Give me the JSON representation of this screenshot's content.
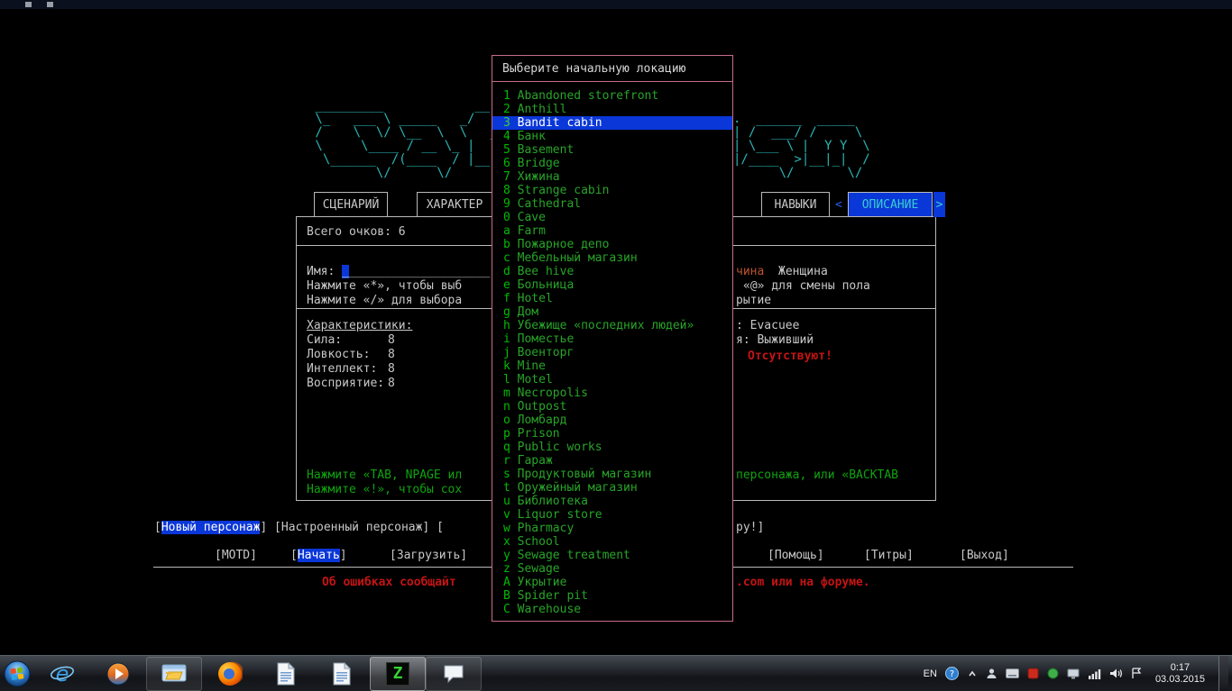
{
  "colors": {
    "terminal_bg": "#000000",
    "text_white": "#c8c8c8",
    "ascii_cyan": "#2cb5b5",
    "help_green": "#0fa30f",
    "error_red": "#c41414",
    "selection_blue": "#0a37d8",
    "dialog_border_pink": "#c76b8d",
    "gender_selected_brown": "#bf5330"
  },
  "game": {
    "logo_lines": [
      " _________            __                   .__",
      " \\_   ___ \\ _____   _/  |_ _____     ____  |  |   ___.__.  ______  _____",
      " /    \\  \\/ \\__  \\  \\   __\\\\__  \\  _/ ___\\ |  |  <   |  | /  ___/ /     \\",
      " \\     \\____ / __ \\_ |  |   / __ \\_\\  \\___ |  |__ \\___  | \\___ \\ |  Y Y  \\",
      "  \\______  /(____  / |__|  (____  / \\___  >|____/ / ____|/____  >|__|_|  /",
      "         \\/      \\/             \\/      \\/        \\/          \\/       \\/"
    ],
    "tabs": {
      "scenario": "СЦЕНАРИЙ",
      "character": "ХАРАКТЕР",
      "skills": "НАВЫКИ",
      "description": "ОПИСАНИЕ",
      "prev_arrow": "<",
      "next_arrow": ">"
    },
    "points_line": "Всего очков: 6",
    "name_row": {
      "label": "Имя: ",
      "cursor": "_",
      "underscores": "____________________"
    },
    "hints_left": {
      "line1": "Нажмите «*», чтобы выб",
      "line2": "Нажмите «/» для выбора"
    },
    "gender": {
      "male_fragment": "чина",
      "female": "Женщина",
      "hint_fragment": "«@» для смены пола",
      "shelter_fragment": "рытие"
    },
    "stats": {
      "header": "Характеристики:",
      "rows": [
        {
          "label": "Сила:",
          "value": "8"
        },
        {
          "label": "Ловкость:",
          "value": "8"
        },
        {
          "label": "Интеллект:",
          "value": "8"
        },
        {
          "label": "Восприятие:",
          "value": "8"
        }
      ]
    },
    "right_info": {
      "scenario_fragment": ": Evacuee",
      "profession_fragment": "я: Выживший",
      "skills_missing": "Отсутствуют!"
    },
    "help_green": {
      "line1_left": "Нажмите «TAB, NPAGE ил",
      "line1_right": "персонажа, или «BACKTAB",
      "line2_left": "Нажмите «!», чтобы сох"
    },
    "menu_row1": {
      "open_bracket": "[",
      "new_character": "Новый персонаж",
      "rest": "] [Настроенный персонаж] [",
      "right_fragment": "ру!]"
    },
    "menu_row2": {
      "motd": "[MOTD]",
      "start_open": "[",
      "start": "Начать",
      "start_close": "]",
      "load": "[Загрузить]",
      "help": "[Помощь]",
      "credits": "[Титры]",
      "quit": "[Выход]"
    },
    "bug_line": {
      "left_fragment": "Об ошибках сообщайт",
      "right_fragment": ".com или на форуме."
    }
  },
  "dialog": {
    "title": "Выберите начальную локацию",
    "items": [
      {
        "key": "1",
        "label": "Abandoned storefront",
        "selected": false
      },
      {
        "key": "2",
        "label": "Anthill",
        "selected": false
      },
      {
        "key": "3",
        "label": "Bandit cabin",
        "selected": true
      },
      {
        "key": "4",
        "label": "Банк",
        "selected": false
      },
      {
        "key": "5",
        "label": "Basement",
        "selected": false
      },
      {
        "key": "6",
        "label": "Bridge",
        "selected": false
      },
      {
        "key": "7",
        "label": "Хижина",
        "selected": false
      },
      {
        "key": "8",
        "label": "Strange cabin",
        "selected": false
      },
      {
        "key": "9",
        "label": "Cathedral",
        "selected": false
      },
      {
        "key": "0",
        "label": "Cave",
        "selected": false
      },
      {
        "key": "a",
        "label": "Farm",
        "selected": false
      },
      {
        "key": "b",
        "label": "Пожарное депо",
        "selected": false
      },
      {
        "key": "c",
        "label": "Мебельный магазин",
        "selected": false
      },
      {
        "key": "d",
        "label": "Bee hive",
        "selected": false
      },
      {
        "key": "e",
        "label": "Больница",
        "selected": false
      },
      {
        "key": "f",
        "label": "Hotel",
        "selected": false
      },
      {
        "key": "g",
        "label": "Дом",
        "selected": false
      },
      {
        "key": "h",
        "label": "Убежище «последних людей»",
        "selected": false
      },
      {
        "key": "i",
        "label": "Поместье",
        "selected": false
      },
      {
        "key": "j",
        "label": "Военторг",
        "selected": false
      },
      {
        "key": "k",
        "label": "Mine",
        "selected": false
      },
      {
        "key": "l",
        "label": "Motel",
        "selected": false
      },
      {
        "key": "m",
        "label": "Necropolis",
        "selected": false
      },
      {
        "key": "n",
        "label": "Outpost",
        "selected": false
      },
      {
        "key": "o",
        "label": "Ломбард",
        "selected": false
      },
      {
        "key": "p",
        "label": "Prison",
        "selected": false
      },
      {
        "key": "q",
        "label": "Public works",
        "selected": false
      },
      {
        "key": "r",
        "label": "Гараж",
        "selected": false
      },
      {
        "key": "s",
        "label": "Продуктовый магазин",
        "selected": false
      },
      {
        "key": "t",
        "label": "Оружейный магазин",
        "selected": false
      },
      {
        "key": "u",
        "label": "Библиотека",
        "selected": false
      },
      {
        "key": "v",
        "label": "Liquor store",
        "selected": false
      },
      {
        "key": "w",
        "label": "Pharmacy",
        "selected": false
      },
      {
        "key": "x",
        "label": "School",
        "selected": false
      },
      {
        "key": "y",
        "label": "Sewage treatment",
        "selected": false
      },
      {
        "key": "z",
        "label": "Sewage",
        "selected": false
      },
      {
        "key": "A",
        "label": "Укрытие",
        "selected": false
      },
      {
        "key": "B",
        "label": "Spider pit",
        "selected": false
      },
      {
        "key": "C",
        "label": "Warehouse",
        "selected": false
      }
    ]
  },
  "taskbar": {
    "apps": [
      {
        "name": "internet-explorer",
        "glyph": "e"
      },
      {
        "name": "media-player",
        "glyph": ""
      },
      {
        "name": "file-explorer",
        "glyph": ""
      },
      {
        "name": "firefox",
        "glyph": ""
      },
      {
        "name": "document-1",
        "glyph": ""
      },
      {
        "name": "document-2",
        "glyph": ""
      },
      {
        "name": "z-terminal",
        "glyph": "Z"
      },
      {
        "name": "messenger",
        "glyph": ""
      }
    ],
    "tray": {
      "language": "EN",
      "time": "0:17",
      "date": "03.03.2015"
    }
  }
}
